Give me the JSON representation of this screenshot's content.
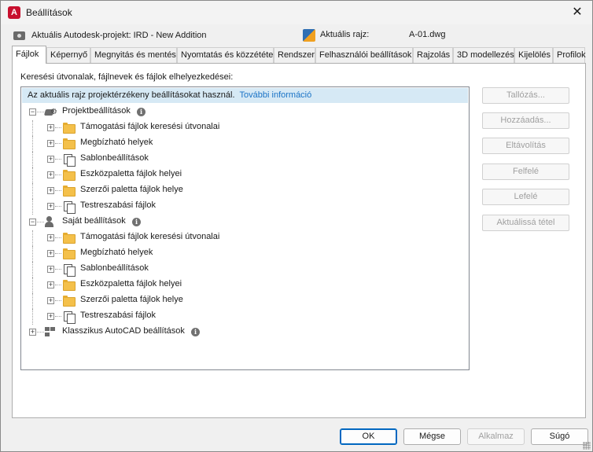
{
  "window": {
    "title": "Beállítások",
    "app_icon_letter": "A",
    "close_glyph": "✕"
  },
  "project": {
    "label": "Aktuális Autodesk-projekt: IRD - New Addition",
    "drawing_label": "Aktuális rajz:",
    "drawing_value": "A-01.dwg"
  },
  "tabs": [
    {
      "label": "Fájlok",
      "active": true
    },
    {
      "label": "Képernyő"
    },
    {
      "label": "Megnyitás és mentés"
    },
    {
      "label": "Nyomtatás és közzététel"
    },
    {
      "label": "Rendszer"
    },
    {
      "label": "Felhasználói beállítások"
    },
    {
      "label": "Rajzolás"
    },
    {
      "label": "3D modellezés"
    },
    {
      "label": "Kijelölés"
    },
    {
      "label": "Profilok"
    }
  ],
  "files": {
    "caption": "Keresési útvonalak, fájlnevek és fájlok elhelyezkedései:",
    "info_text": "Az aktuális rajz projektérzékeny beállításokat használ.",
    "info_link": "További információ",
    "info_badge": "i",
    "groups": [
      {
        "label": "Projektbeállítások",
        "icon": "project-settings-icon",
        "expander": "−",
        "children": [
          {
            "label": "Támogatási fájlok keresési útvonalai",
            "icon": "folder-icon"
          },
          {
            "label": "Megbízható helyek",
            "icon": "folder-icon"
          },
          {
            "label": "Sablonbeállítások",
            "icon": "template-files-icon"
          },
          {
            "label": "Eszközpaletta fájlok helyei",
            "icon": "folder-icon"
          },
          {
            "label": "Szerzői paletta fájlok helye",
            "icon": "folder-icon"
          },
          {
            "label": "Testreszabási fájlok",
            "icon": "template-files-icon"
          }
        ]
      },
      {
        "label": "Saját beállítások",
        "icon": "user-settings-icon",
        "expander": "−",
        "children": [
          {
            "label": "Támogatási fájlok keresési útvonalai",
            "icon": "folder-icon"
          },
          {
            "label": "Megbízható helyek",
            "icon": "folder-icon"
          },
          {
            "label": "Sablonbeállítások",
            "icon": "template-files-icon"
          },
          {
            "label": "Eszközpaletta fájlok helyei",
            "icon": "folder-icon"
          },
          {
            "label": "Szerzői paletta fájlok helye",
            "icon": "folder-icon"
          },
          {
            "label": "Testreszabási fájlok",
            "icon": "template-files-icon"
          }
        ]
      },
      {
        "label": "Klasszikus AutoCAD beállítások",
        "icon": "classic-settings-icon",
        "expander": "+",
        "children": []
      }
    ],
    "child_expander": "+"
  },
  "side_buttons": [
    "Tallózás...",
    "Hozzáadás...",
    "Eltávolítás",
    "Felfelé",
    "Lefelé",
    "Aktuálissá tétel"
  ],
  "footer": {
    "ok": "OK",
    "cancel": "Mégse",
    "apply": "Alkalmaz",
    "help": "Súgó"
  },
  "colors": {
    "info_bar": "#d6e9f5",
    "link": "#1a73c6",
    "folder": "#f4c04a",
    "app_icon": "#c8102e"
  }
}
